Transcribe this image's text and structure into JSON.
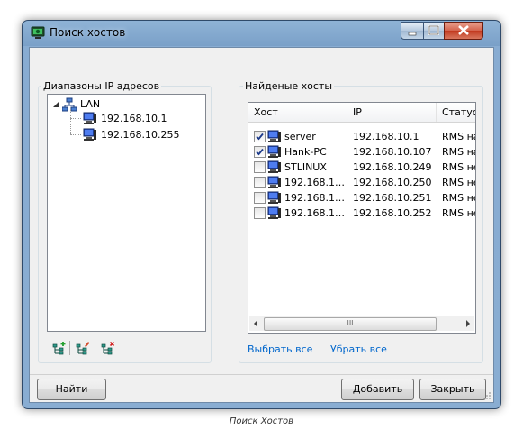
{
  "window": {
    "title": "Поиск хостов"
  },
  "ranges": {
    "group_label": "Диапазоны IP адресов",
    "tree": {
      "root": {
        "label": "LAN",
        "icon": "network-icon",
        "expanded": true
      },
      "children": [
        {
          "label": "192.168.10.1",
          "icon": "computer-icon"
        },
        {
          "label": "192.168.10.255",
          "icon": "computer-icon"
        }
      ]
    },
    "toolbar": [
      "add-range-icon",
      "edit-range-icon",
      "delete-range-icon"
    ]
  },
  "found": {
    "group_label": "Найденые хосты",
    "columns": [
      "Хост",
      "IP",
      "Статус"
    ],
    "rows": [
      {
        "checked": true,
        "host": "server",
        "ip": "192.168.10.1",
        "status": "RMS найд"
      },
      {
        "checked": true,
        "host": "Hank-PC",
        "ip": "192.168.10.107",
        "status": "RMS найд"
      },
      {
        "checked": false,
        "host": "STLINUX",
        "ip": "192.168.10.249",
        "status": "RMS не н"
      },
      {
        "checked": false,
        "host": "192.168.1…",
        "ip": "192.168.10.250",
        "status": "RMS не н"
      },
      {
        "checked": false,
        "host": "192.168.1…",
        "ip": "192.168.10.251",
        "status": "RMS не н"
      },
      {
        "checked": false,
        "host": "192.168.1…",
        "ip": "192.168.10.252",
        "status": "RMS не н"
      }
    ],
    "scroll_thumb_glyph": "III",
    "select_all": "Выбрать все",
    "deselect_all": "Убрать все"
  },
  "buttons": {
    "find": "Найти",
    "add": "Добавить",
    "close": "Закрыть"
  },
  "caption": "Поиск Хостов"
}
